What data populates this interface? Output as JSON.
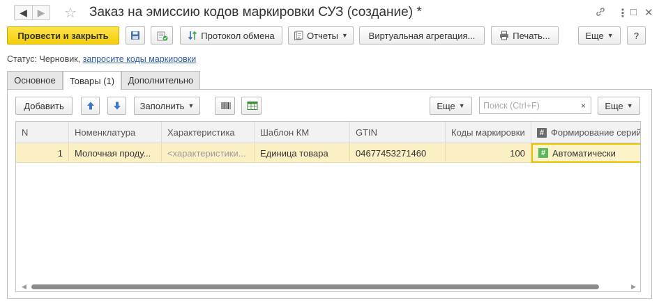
{
  "window": {
    "title": "Заказ на эмиссию кодов маркировки СУЗ (создание) *",
    "back_symbol": "◀",
    "forward_symbol": "▶",
    "favorite_symbol": "☆",
    "link_symbol": "🔗",
    "menu_symbol": "⋮",
    "maximize_symbol": "□",
    "close_symbol": "✕"
  },
  "toolbar": {
    "post_close": "Провести и закрыть",
    "exchange_log": "Протокол обмена",
    "reports": "Отчеты",
    "virtual_aggregation": "Виртуальная агрегация...",
    "print": "Печать...",
    "more": "Еще",
    "help": "?"
  },
  "status": {
    "label": "Статус:",
    "value": "Черновик,",
    "link": "запросите коды маркировки"
  },
  "tabs": [
    {
      "label": "Основное"
    },
    {
      "label": "Товары (1)"
    },
    {
      "label": "Дополнительно"
    }
  ],
  "table_toolbar": {
    "add": "Добавить",
    "fill": "Заполнить",
    "more_left": "Еще",
    "search_placeholder": "Поиск (Ctrl+F)",
    "search_clear": "×",
    "more_right": "Еще"
  },
  "table": {
    "columns": [
      "N",
      "Номенклатура",
      "Характеристика",
      "Шаблон КМ",
      "GTIN",
      "Коды маркировки",
      "Формирование серий"
    ],
    "rows": [
      {
        "n": "1",
        "nomenclature": "Молочная проду...",
        "characteristic": "<характеристики...",
        "template": "Единица товара",
        "gtin": "04677453271460",
        "codes": "100",
        "series": "Автоматически"
      }
    ]
  },
  "colors": {
    "primary_button": "#f4cd0a",
    "selected_row": "#fbf0c4",
    "link": "#2b5ea8",
    "hash_badge_header": "#6b6b6b",
    "hash_badge_cell": "#5cb85c"
  },
  "icons": [
    "back-icon",
    "forward-icon",
    "star-icon",
    "link-icon",
    "more-vertical-icon",
    "maximize-icon",
    "close-icon",
    "save-icon",
    "post-icon",
    "exchange-icon",
    "reports-icon",
    "print-icon",
    "arrow-up-icon",
    "arrow-down-icon",
    "barcode-icon",
    "excel-icon"
  ]
}
